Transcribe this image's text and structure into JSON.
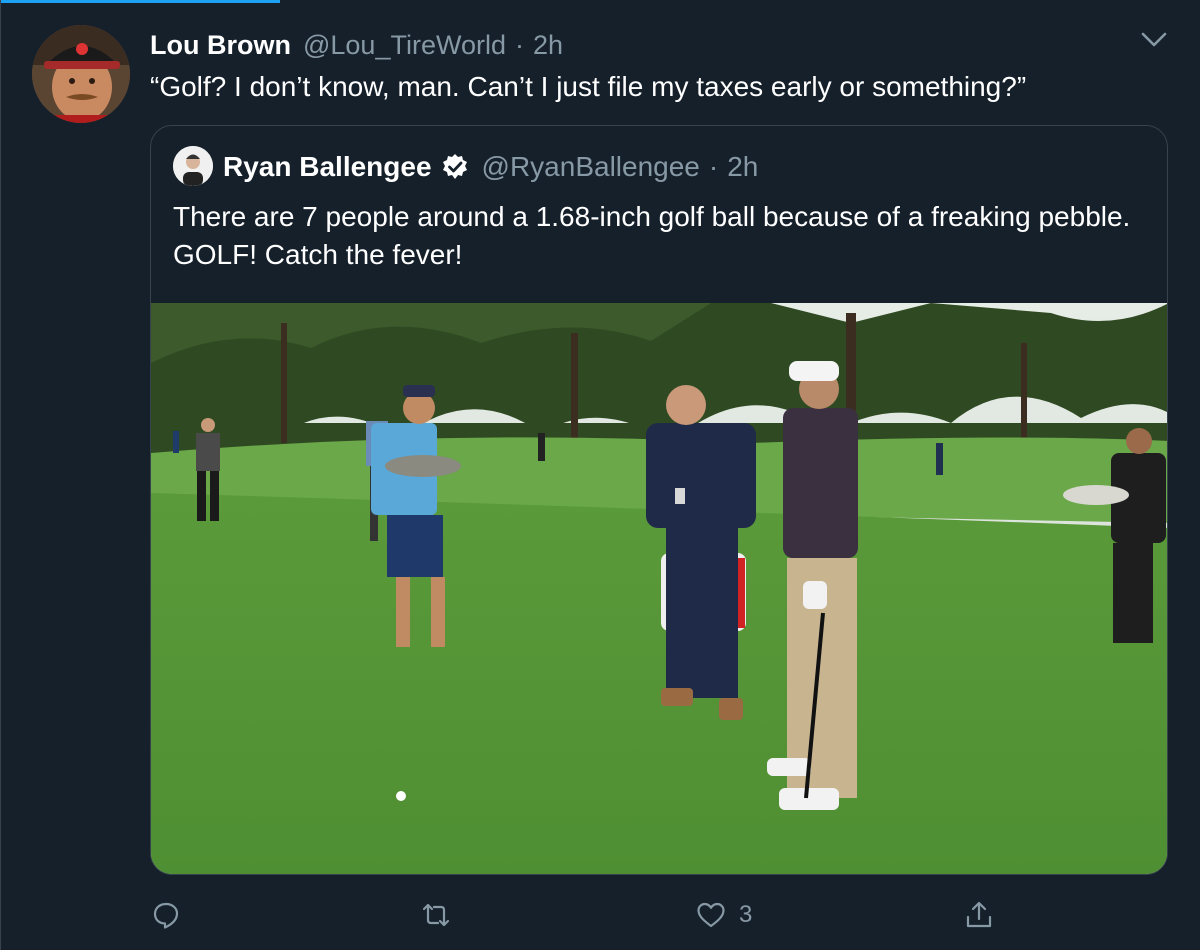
{
  "tweet": {
    "author_name": "Lou Brown",
    "author_handle": "@Lou_TireWorld",
    "separator": "·",
    "time": "2h",
    "text": "“Golf? I don’t know, man. Can’t I just file my taxes early or something?”"
  },
  "quoted_tweet": {
    "author_name": "Ryan Ballengee",
    "verified": true,
    "author_handle": "@RyanBallengee",
    "separator": "·",
    "time": "2h",
    "text": "There are 7 people around a 1.68-inch golf ball because of a freaking pebble. GOLF! Catch the fever!"
  },
  "actions": {
    "reply_icon": "reply-icon",
    "retweet_icon": "retweet-icon",
    "like_icon": "heart-icon",
    "like_count": "3",
    "share_icon": "share-icon"
  },
  "colors": {
    "background": "#15202b",
    "border": "#38444d",
    "muted_text": "#8899a6",
    "accent": "#1da1f2"
  }
}
